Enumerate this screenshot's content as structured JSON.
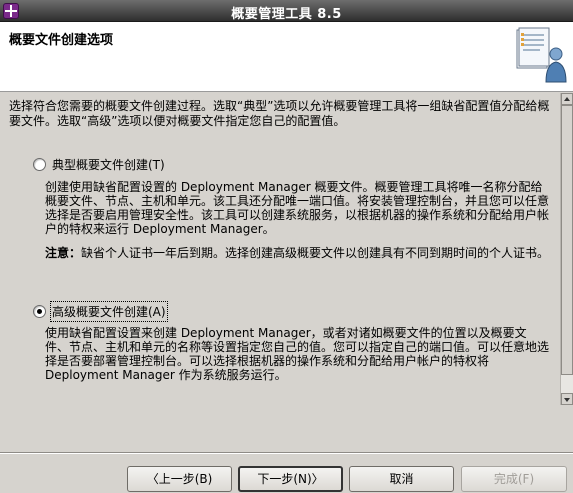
{
  "window": {
    "title": "概要管理工具 8.5",
    "app_icon": "profile-tool-icon"
  },
  "header": {
    "title": "概要文件创建选项",
    "graphic_icon": "document-person-icon"
  },
  "main": {
    "intro": "选择符合您需要的概要文件创建过程。选取“典型”选项以允许概要管理工具将一组缺省配置值分配给概要文件。选取“高级”选项以便对概要文件指定您自己的配置值。",
    "options": [
      {
        "label": "典型概要文件创建(T)",
        "selected": false,
        "description": "创建使用缺省配置设置的 Deployment Manager 概要文件。概要管理工具将唯一名称分配给概要文件、节点、主机和单元。该工具还分配唯一端口值。将安装管理控制台，并且您可以任意选择是否要启用管理安全性。该工具可以创建系统服务，以根据机器的操作系统和分配给用户帐户的特权来运行 Deployment Manager。",
        "note_label": "注意：",
        "note_text": "缺省个人证书一年后到期。选择创建高级概要文件以创建具有不同到期时间的个人证书。"
      },
      {
        "label": "高级概要文件创建(A)",
        "selected": true,
        "description": "使用缺省配置设置来创建 Deployment Manager，或者对诸如概要文件的位置以及概要文件、节点、主机和单元的名称等设置指定您自己的值。您可以指定自己的端口值。可以任意地选择是否要部署管理控制台。可以选择根据机器的操作系统和分配给用户帐户的特权将 Deployment Manager 作为系统服务运行。"
      }
    ]
  },
  "footer": {
    "back": "〈上一步(B)",
    "next": "下一步(N)〉",
    "cancel": "取消",
    "finish": "完成(F)"
  }
}
